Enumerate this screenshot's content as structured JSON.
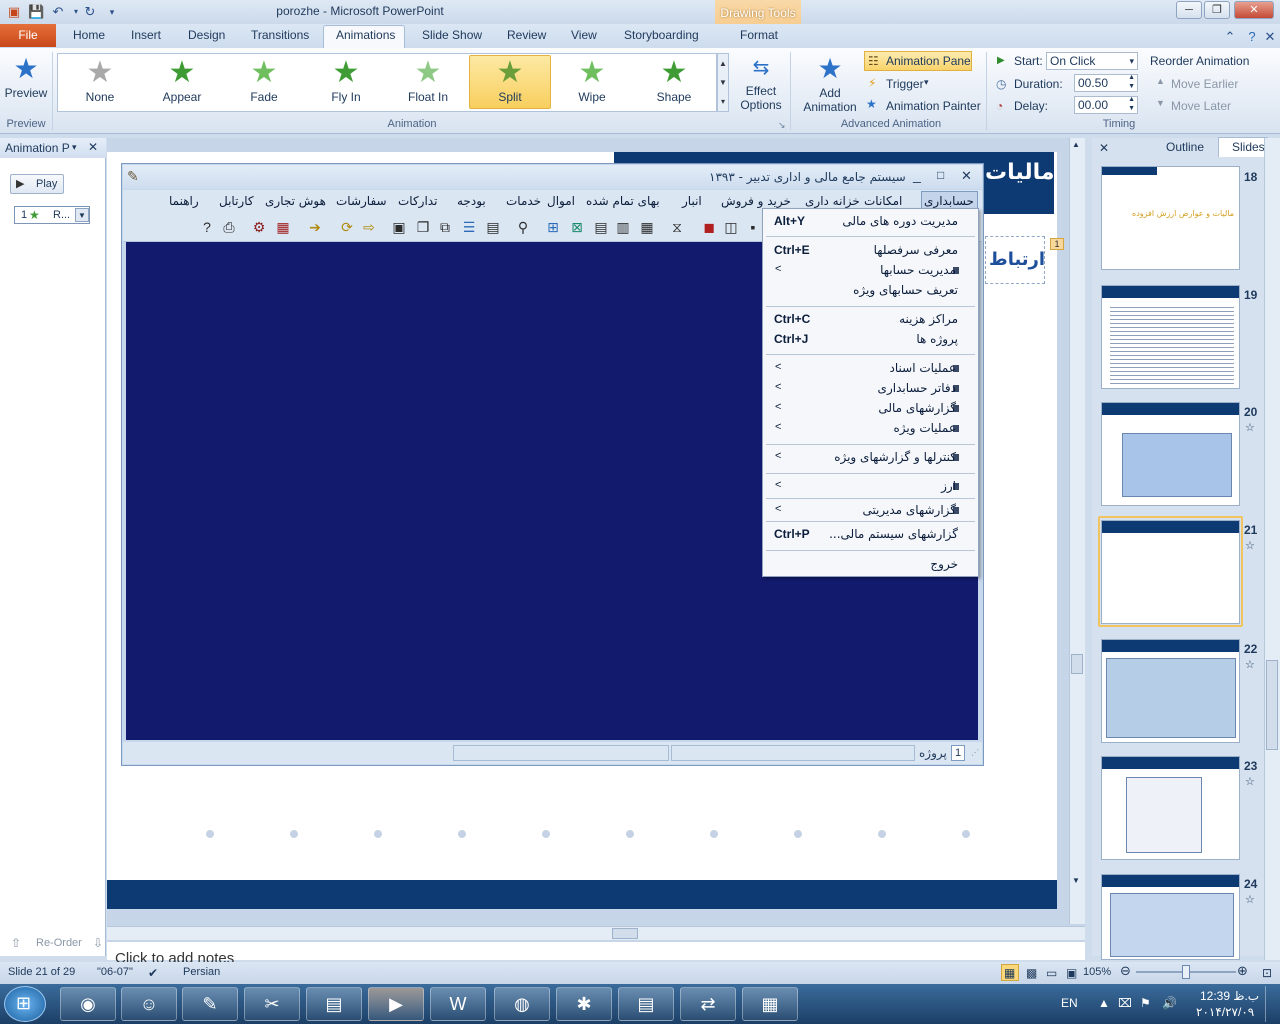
{
  "window": {
    "title": "porozhe  -  Microsoft PowerPoint",
    "drawing_tools": "Drawing Tools",
    "controls": [
      "─",
      "❐",
      "✕"
    ]
  },
  "tabs": [
    "File",
    "Home",
    "Insert",
    "Design",
    "Transitions",
    "Animations",
    "Slide Show",
    "Review",
    "View",
    "Storyboarding",
    "Format"
  ],
  "ribbon": {
    "preview": {
      "label": "Preview",
      "group": "Preview"
    },
    "animations": {
      "items": [
        "None",
        "Appear",
        "Fade",
        "Fly In",
        "Float In",
        "Split",
        "Wipe",
        "Shape"
      ],
      "selected": "Split",
      "effect_options_1": "Effect",
      "effect_options_2": "Options",
      "group": "Animation"
    },
    "advanced": {
      "add_1": "Add",
      "add_2": "Animation",
      "animation_pane": "Animation Pane",
      "trigger": "Trigger",
      "painter": "Animation Painter",
      "group": "Advanced Animation"
    },
    "timing": {
      "start_label": "Start:",
      "start_value": "On Click",
      "duration_label": "Duration:",
      "duration_value": "00.50",
      "delay_label": "Delay:",
      "delay_value": "00.00",
      "reorder": "Reorder Animation",
      "earlier": "Move Earlier",
      "later": "Move Later",
      "group": "Timing"
    }
  },
  "anim_pane": {
    "title": "Animation P",
    "play": "Play",
    "item_num": "1",
    "item_label": "R...",
    "reorder": "Re-Order"
  },
  "slide": {
    "title": "مالیات",
    "ertebat": "ارتباط",
    "tag": "1"
  },
  "app": {
    "title": "سیستم جامع مالی و اداری تدبیر - ۱۳۹۳",
    "menu": [
      "حسابداری",
      "امکانات",
      "خزانه داری",
      "خرید و فروش",
      "انبار",
      "بهای تمام شده",
      "اموال",
      "خدمات",
      "بودجه",
      "تدارکات",
      "سفارشات",
      "هوش تجاری",
      "کارتابل",
      "راهنما"
    ],
    "status_project": "پروژه",
    "status_num": "1"
  },
  "dropdown": [
    {
      "label": "مدیریت دوره های مالی",
      "shortcut": "Alt+Y"
    },
    {
      "label": "معرفی سرفصلها",
      "shortcut": "Ctrl+E"
    },
    {
      "label": "مدیریت حسابها",
      "arrow": "<"
    },
    {
      "label": "تعریف حسابهای ویژه"
    },
    {
      "label": "مراکز هزینه",
      "shortcut": "Ctrl+C"
    },
    {
      "label": "پروژه ها",
      "shortcut": "Ctrl+J"
    },
    {
      "label": "عملیات اسناد",
      "arrow": "<"
    },
    {
      "label": "دفاتر حسابداری",
      "arrow": "<"
    },
    {
      "label": "گزارشهای مالی",
      "arrow": "<"
    },
    {
      "label": "عملیات ویژه",
      "arrow": "<"
    },
    {
      "label": "کنترلها و گزارشهای ویژه",
      "arrow": "<"
    },
    {
      "label": "ارز",
      "arrow": "<"
    },
    {
      "label": "گزارشهای مدیریتی",
      "arrow": "<"
    },
    {
      "label": "گزارشهای سیستم مالی...",
      "shortcut": "Ctrl+P"
    },
    {
      "label": "خروج"
    }
  ],
  "panel": {
    "outline": "Outline",
    "slides": "Slides",
    "thumb_numbers": [
      "18",
      "19",
      "20",
      "21",
      "22",
      "23",
      "24"
    ],
    "thumb18_text": "مالیات و عوارض ارزش افزوده"
  },
  "notes": "Click to add notes",
  "status": {
    "slide": "Slide 21 of 29",
    "theme": "\"06-07\"",
    "lang": "Persian",
    "zoom": "105%"
  },
  "taskbar": {
    "lang": "EN",
    "time": "12:39 ب.ظ",
    "date": "۲۰۱۴/۲۷/۰۹"
  }
}
